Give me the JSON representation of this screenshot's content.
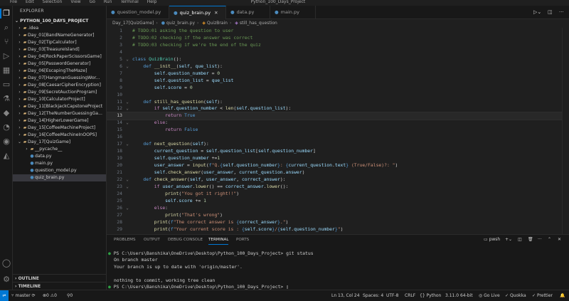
{
  "menu": [
    "File",
    "Edit",
    "Selection",
    "View",
    "Go",
    "Run",
    "Terminal",
    "Help"
  ],
  "window_title": "Python_100_Days_Project",
  "sidebar": {
    "header": "EXPLORER",
    "project": "PYTHON_100_DAYS_PROJECT",
    "items": [
      {
        "label": ".idea",
        "type": "folder",
        "depth": 1,
        "open": false
      },
      {
        "label": "Day_01[BandNameGenerator]",
        "type": "folder",
        "depth": 1,
        "open": false
      },
      {
        "label": "Day_02[TipCalculator]",
        "type": "folder",
        "depth": 1,
        "open": false
      },
      {
        "label": "Day_03[TreasureIsland]",
        "type": "folder",
        "depth": 1,
        "open": false
      },
      {
        "label": "Day_04[RockPaperScissorsGame]",
        "type": "folder",
        "depth": 1,
        "open": false
      },
      {
        "label": "Day_05[PasswordGenerator]",
        "type": "folder",
        "depth": 1,
        "open": false
      },
      {
        "label": "Day_06[EscapingTheMaze]",
        "type": "folder",
        "depth": 1,
        "open": false
      },
      {
        "label": "Day_07[HangmanGuessingWor...",
        "type": "folder",
        "depth": 1,
        "open": false
      },
      {
        "label": "Day_08[CaesarCipherEncryption]",
        "type": "folder",
        "depth": 1,
        "open": false
      },
      {
        "label": "Day_09[SecretAuctionProgram]",
        "type": "folder",
        "depth": 1,
        "open": false
      },
      {
        "label": "Day_10[CalculatorProject]",
        "type": "folder",
        "depth": 1,
        "open": false
      },
      {
        "label": "Day_11[BlackjackCapstoneProject",
        "type": "folder",
        "depth": 1,
        "open": false
      },
      {
        "label": "Day_12[TheNumberGuessingGa...",
        "type": "folder",
        "depth": 1,
        "open": false
      },
      {
        "label": "Day_14[HigherLowerGame]",
        "type": "folder",
        "depth": 1,
        "open": false
      },
      {
        "label": "Day_15[CoffeeMachineProject]",
        "type": "folder",
        "depth": 1,
        "open": false
      },
      {
        "label": "Day_16[CoffeeMachineInOOPS]",
        "type": "folder",
        "depth": 1,
        "open": false
      },
      {
        "label": "Day_17[QuizGame]",
        "type": "folder",
        "depth": 1,
        "open": true
      },
      {
        "label": "__pycache__",
        "type": "folder",
        "depth": 2,
        "open": false
      },
      {
        "label": "data.py",
        "type": "file",
        "depth": 2
      },
      {
        "label": "main.py",
        "type": "file",
        "depth": 2
      },
      {
        "label": "question_model.py",
        "type": "file",
        "depth": 2
      },
      {
        "label": "quiz_brain.py",
        "type": "file",
        "depth": 2,
        "selected": true
      }
    ],
    "outline_label": "OUTLINE",
    "timeline_label": "TIMELINE"
  },
  "tabs": [
    {
      "label": "question_model.py",
      "active": false
    },
    {
      "label": "quiz_brain.py",
      "active": true
    },
    {
      "label": "data.py",
      "active": false
    },
    {
      "label": "main.py",
      "active": false
    }
  ],
  "breadcrumb": [
    "Day_17[QuizGame]",
    "quiz_brain.py",
    "QuizBrain",
    "still_has_question"
  ],
  "code_lines": [
    {
      "n": 1,
      "t": [
        [
          "c",
          "# TODO:01 asking the question to user"
        ]
      ]
    },
    {
      "n": 2,
      "t": [
        [
          "c",
          "# TODO:02 checking if the answer was correct"
        ]
      ]
    },
    {
      "n": 3,
      "t": [
        [
          "c",
          "# TODO:03 checking if we're the end of the quiz"
        ]
      ]
    },
    {
      "n": 4,
      "t": []
    },
    {
      "n": 5,
      "f": true,
      "t": [
        [
          "k",
          "class "
        ],
        [
          "cn",
          "QuizBrain"
        ],
        [
          "p",
          "():"
        ]
      ]
    },
    {
      "n": 6,
      "f": true,
      "t": [
        [
          "p",
          "    "
        ],
        [
          "k",
          "def "
        ],
        [
          "fn",
          "__init__"
        ],
        [
          "p",
          "("
        ],
        [
          "v",
          "self"
        ],
        [
          "p",
          ", "
        ],
        [
          "v",
          "que_list"
        ],
        [
          "p",
          "):"
        ]
      ]
    },
    {
      "n": 7,
      "t": [
        [
          "p",
          "        "
        ],
        [
          "v",
          "self"
        ],
        [
          "p",
          "."
        ],
        [
          "v",
          "question_number"
        ],
        [
          "p",
          " = "
        ],
        [
          "n",
          "0"
        ]
      ]
    },
    {
      "n": 8,
      "t": [
        [
          "p",
          "        "
        ],
        [
          "v",
          "self"
        ],
        [
          "p",
          "."
        ],
        [
          "v",
          "question_list"
        ],
        [
          "p",
          " = "
        ],
        [
          "v",
          "que_list"
        ]
      ]
    },
    {
      "n": 9,
      "t": [
        [
          "p",
          "        "
        ],
        [
          "v",
          "self"
        ],
        [
          "p",
          "."
        ],
        [
          "v",
          "score"
        ],
        [
          "p",
          " = "
        ],
        [
          "n",
          "0"
        ]
      ]
    },
    {
      "n": 10,
      "t": []
    },
    {
      "n": 11,
      "f": true,
      "t": [
        [
          "p",
          "    "
        ],
        [
          "k",
          "def "
        ],
        [
          "fn",
          "still_has_question"
        ],
        [
          "p",
          "("
        ],
        [
          "v",
          "self"
        ],
        [
          "p",
          "):"
        ]
      ]
    },
    {
      "n": 12,
      "f": true,
      "t": [
        [
          "p",
          "        "
        ],
        [
          "kc",
          "if "
        ],
        [
          "v",
          "self"
        ],
        [
          "p",
          "."
        ],
        [
          "v",
          "question_number"
        ],
        [
          "p",
          " < "
        ],
        [
          "fn",
          "len"
        ],
        [
          "p",
          "("
        ],
        [
          "v",
          "self"
        ],
        [
          "p",
          "."
        ],
        [
          "v",
          "question_list"
        ],
        [
          "p",
          "):"
        ]
      ]
    },
    {
      "n": 13,
      "cur": true,
      "t": [
        [
          "p",
          "            "
        ],
        [
          "kc",
          "return "
        ],
        [
          "ib",
          "True"
        ]
      ]
    },
    {
      "n": 14,
      "f": true,
      "t": [
        [
          "p",
          "        "
        ],
        [
          "kc",
          "else"
        ],
        [
          "p",
          ":"
        ]
      ]
    },
    {
      "n": 15,
      "t": [
        [
          "p",
          "            "
        ],
        [
          "kc",
          "return "
        ],
        [
          "ib",
          "False"
        ]
      ]
    },
    {
      "n": 16,
      "t": []
    },
    {
      "n": 17,
      "f": true,
      "t": [
        [
          "p",
          "    "
        ],
        [
          "k",
          "def "
        ],
        [
          "fn",
          "next_question"
        ],
        [
          "p",
          "("
        ],
        [
          "v",
          "self"
        ],
        [
          "p",
          "):"
        ]
      ]
    },
    {
      "n": 18,
      "t": [
        [
          "p",
          "        "
        ],
        [
          "v",
          "current_question"
        ],
        [
          "p",
          " = "
        ],
        [
          "v",
          "self"
        ],
        [
          "p",
          "."
        ],
        [
          "v",
          "question_list"
        ],
        [
          "p",
          "["
        ],
        [
          "v",
          "self"
        ],
        [
          "p",
          "."
        ],
        [
          "v",
          "question_number"
        ],
        [
          "p",
          "]"
        ]
      ]
    },
    {
      "n": 19,
      "t": [
        [
          "p",
          "        "
        ],
        [
          "v",
          "self"
        ],
        [
          "p",
          "."
        ],
        [
          "v",
          "question_number"
        ],
        [
          "p",
          " +="
        ],
        [
          "n",
          "1"
        ]
      ]
    },
    {
      "n": 20,
      "t": [
        [
          "p",
          "        "
        ],
        [
          "v",
          "user_answer"
        ],
        [
          "p",
          " = "
        ],
        [
          "fn",
          "input"
        ],
        [
          "p",
          "("
        ],
        [
          "k",
          "f"
        ],
        [
          "s",
          "\"Q."
        ],
        [
          "k",
          "{"
        ],
        [
          "v",
          "self"
        ],
        [
          "p",
          "."
        ],
        [
          "v",
          "question_number"
        ],
        [
          "k",
          "}"
        ],
        [
          "s",
          ": "
        ],
        [
          "k",
          "{"
        ],
        [
          "v",
          "current_question"
        ],
        [
          "p",
          "."
        ],
        [
          "v",
          "text"
        ],
        [
          "k",
          "}"
        ],
        [
          "s",
          " (True/False)?: \""
        ],
        [
          "p",
          ")"
        ]
      ]
    },
    {
      "n": 21,
      "t": [
        [
          "p",
          "        "
        ],
        [
          "v",
          "self"
        ],
        [
          "p",
          "."
        ],
        [
          "fn",
          "check_answer"
        ],
        [
          "p",
          "("
        ],
        [
          "v",
          "user_answer"
        ],
        [
          "p",
          ", "
        ],
        [
          "v",
          "current_question"
        ],
        [
          "p",
          "."
        ],
        [
          "v",
          "answer"
        ],
        [
          "p",
          ")"
        ]
      ]
    },
    {
      "n": 22,
      "f": true,
      "t": [
        [
          "p",
          "    "
        ],
        [
          "k",
          "def "
        ],
        [
          "fn",
          "check_answer"
        ],
        [
          "p",
          "("
        ],
        [
          "v",
          "self"
        ],
        [
          "p",
          ", "
        ],
        [
          "v",
          "user_answer"
        ],
        [
          "p",
          ", "
        ],
        [
          "v",
          "correct_answer"
        ],
        [
          "p",
          "):"
        ]
      ]
    },
    {
      "n": 23,
      "f": true,
      "t": [
        [
          "p",
          "        "
        ],
        [
          "kc",
          "if "
        ],
        [
          "v",
          "user_answer"
        ],
        [
          "p",
          "."
        ],
        [
          "fn",
          "lower"
        ],
        [
          "p",
          "() == "
        ],
        [
          "v",
          "correct_answer"
        ],
        [
          "p",
          "."
        ],
        [
          "fn",
          "lower"
        ],
        [
          "p",
          "():"
        ]
      ]
    },
    {
      "n": 24,
      "t": [
        [
          "p",
          "            "
        ],
        [
          "fn",
          "print"
        ],
        [
          "p",
          "("
        ],
        [
          "s",
          "\"You got it right!!\""
        ],
        [
          "p",
          ")"
        ]
      ]
    },
    {
      "n": 25,
      "t": [
        [
          "p",
          "            "
        ],
        [
          "v",
          "self"
        ],
        [
          "p",
          "."
        ],
        [
          "v",
          "score"
        ],
        [
          "p",
          " += "
        ],
        [
          "n",
          "1"
        ]
      ]
    },
    {
      "n": 26,
      "f": true,
      "t": [
        [
          "p",
          "        "
        ],
        [
          "kc",
          "else"
        ],
        [
          "p",
          ":"
        ]
      ]
    },
    {
      "n": 27,
      "t": [
        [
          "p",
          "            "
        ],
        [
          "fn",
          "print"
        ],
        [
          "p",
          "("
        ],
        [
          "s",
          "\"That's wrong\""
        ],
        [
          "p",
          ")"
        ]
      ]
    },
    {
      "n": 28,
      "t": [
        [
          "p",
          "        "
        ],
        [
          "fn",
          "print"
        ],
        [
          "p",
          "("
        ],
        [
          "k",
          "f"
        ],
        [
          "s",
          "\"The correct answer is "
        ],
        [
          "k",
          "{"
        ],
        [
          "v",
          "correct_answer"
        ],
        [
          "k",
          "}"
        ],
        [
          "s",
          ".\""
        ],
        [
          "p",
          ")"
        ]
      ]
    },
    {
      "n": 29,
      "t": [
        [
          "p",
          "        "
        ],
        [
          "fn",
          "print"
        ],
        [
          "p",
          "("
        ],
        [
          "k",
          "f"
        ],
        [
          "s",
          "\"Your current score is : "
        ],
        [
          "k",
          "{"
        ],
        [
          "v",
          "self"
        ],
        [
          "p",
          "."
        ],
        [
          "v",
          "score"
        ],
        [
          "k",
          "}"
        ],
        [
          "s",
          "/"
        ],
        [
          "k",
          "{"
        ],
        [
          "v",
          "self"
        ],
        [
          "p",
          "."
        ],
        [
          "v",
          "question_number"
        ],
        [
          "k",
          "}"
        ],
        [
          "s",
          "\""
        ],
        [
          "p",
          ")"
        ]
      ]
    }
  ],
  "panel": {
    "tabs": [
      "PROBLEMS",
      "OUTPUT",
      "DEBUG CONSOLE",
      "TERMINAL",
      "PORTS"
    ],
    "active_tab": "TERMINAL",
    "shell": "pwsh",
    "terminal_lines": [
      "PS C:\\Users\\Banshika\\OneDrive\\Desktop\\Python_100_Days_Project> git status",
      "On branch master",
      "Your branch is up to date with 'origin/master'.",
      "",
      "nothing to commit, working tree clean",
      "PS C:\\Users\\Banshika\\OneDrive\\Desktop\\Python_100_Days_Project> "
    ]
  },
  "status": {
    "branch": "master",
    "errors": "0",
    "warnings": "0",
    "ports": "0",
    "position": "Ln 13, Col 24",
    "spaces": "Spaces: 4",
    "encoding": "UTF-8",
    "eol": "CRLF",
    "language": "Python",
    "interpreter": "3.11.0 64-bit",
    "golive": "Go Live",
    "quokka": "Quokka",
    "prettier": "Prettier"
  },
  "colors": {
    "accent": "#0078d4",
    "bg": "#1f1f1f",
    "sidebar": "#181818"
  }
}
